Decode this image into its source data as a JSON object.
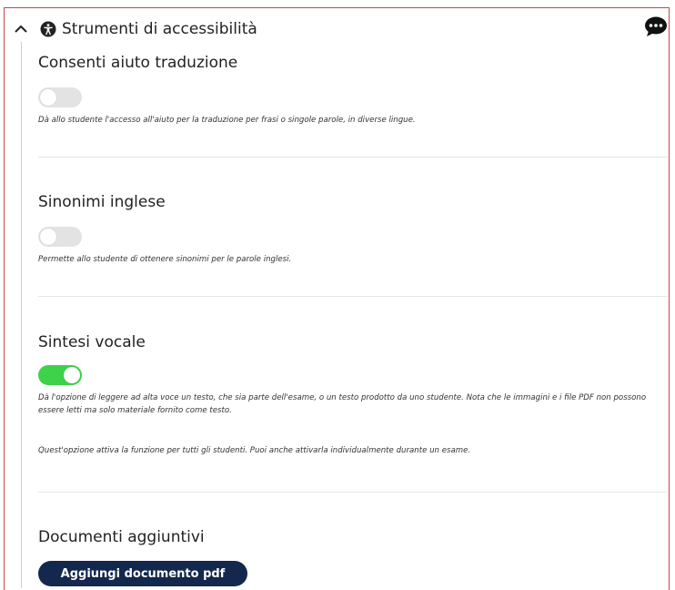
{
  "header": {
    "title": "Strumenti di accessibilità"
  },
  "sections": [
    {
      "title": "Consenti aiuto traduzione",
      "toggle_on": false,
      "description": "Dà allo studente l'accesso all'aiuto per la traduzione per frasi o singole parole, in diverse lingue."
    },
    {
      "title": "Sinonimi inglese",
      "toggle_on": false,
      "description": "Permette allo studente di ottenere sinonimi per le parole inglesi."
    },
    {
      "title": "Sintesi vocale",
      "toggle_on": true,
      "description": "Dà l'opzione di leggere ad alta voce un testo, che sia parte dell'esame, o un testo prodotto da uno studente. Nota che le immagini e i file PDF non possono essere letti ma solo materiale fornito come testo.",
      "note": "Quest'opzione attiva la funzione per tutti gli studenti. Puoi anche attivarla individualmente durante un esame."
    }
  ],
  "documents": {
    "title": "Documenti aggiuntivi",
    "button_label": "Aggiungi documento pdf"
  },
  "colors": {
    "toggle_on": "#3ed14a",
    "toggle_off": "#e3e3e3",
    "button_bg": "#14284d",
    "frame_border": "#c94545"
  }
}
